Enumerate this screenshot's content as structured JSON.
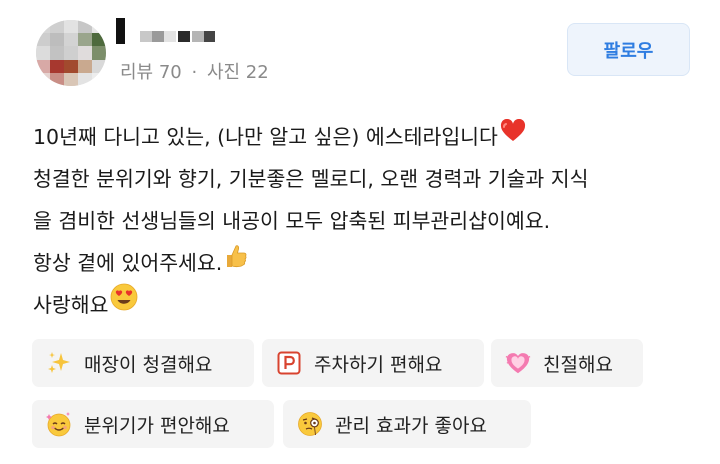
{
  "profile": {
    "avatar_colors": [
      "#d6d6d6",
      "#cfcfcf",
      "#e2e2e2",
      "#c7c7c7",
      "#e6e6e6",
      "#cdcdcd",
      "#bdbdbd",
      "#d3d3d3",
      "#9aa58c",
      "#4e6a3d",
      "#dcdcdc",
      "#c2c2c2",
      "#cfcfcf",
      "#e0dcdc",
      "#7c8e6a",
      "#d8a9a6",
      "#a7382f",
      "#a24a2e",
      "#c9a98f",
      "#d9d9d9",
      "#e6d4d1",
      "#c98e86",
      "#d9c6b6",
      "#e3e3e3",
      "#ededed"
    ],
    "meta_reviews": "리뷰 70",
    "meta_separator": "·",
    "meta_photos": "사진 22"
  },
  "follow_button": {
    "label": "팔로우"
  },
  "review": {
    "lines": [
      "10년째 다니고 있는, (나만 알고 싶은) 에스테라입니다",
      "청결한 분위기와 향기, 기분좋은 멜로디, 오랜 경력과 기술과 지식",
      "을 겸비한 선생님들의 내공이 모두 압축된 피부관리샵이예요.",
      "항상 곁에 있어주세요.",
      "사랑해요"
    ],
    "emojis": [
      "red-heart-icon",
      "thumbs-up-icon",
      "heart-eyes-face-icon"
    ]
  },
  "tags": [
    {
      "label": "매장이 청결해요",
      "icon": "sparkles-icon"
    },
    {
      "label": "주차하기 편해요",
      "icon": "parking-icon"
    },
    {
      "label": "친절해요",
      "icon": "growing-heart-icon"
    },
    {
      "label": "분위기가 편안해요",
      "icon": "smiling-face-icon"
    },
    {
      "label": "관리 효과가 좋아요",
      "icon": "face-with-monocle-icon"
    }
  ],
  "colors": {
    "accent": "#2f7de1",
    "follow_bg": "#eef4fc",
    "tag_bg": "#f4f4f4",
    "meta": "#8a8a8a"
  }
}
